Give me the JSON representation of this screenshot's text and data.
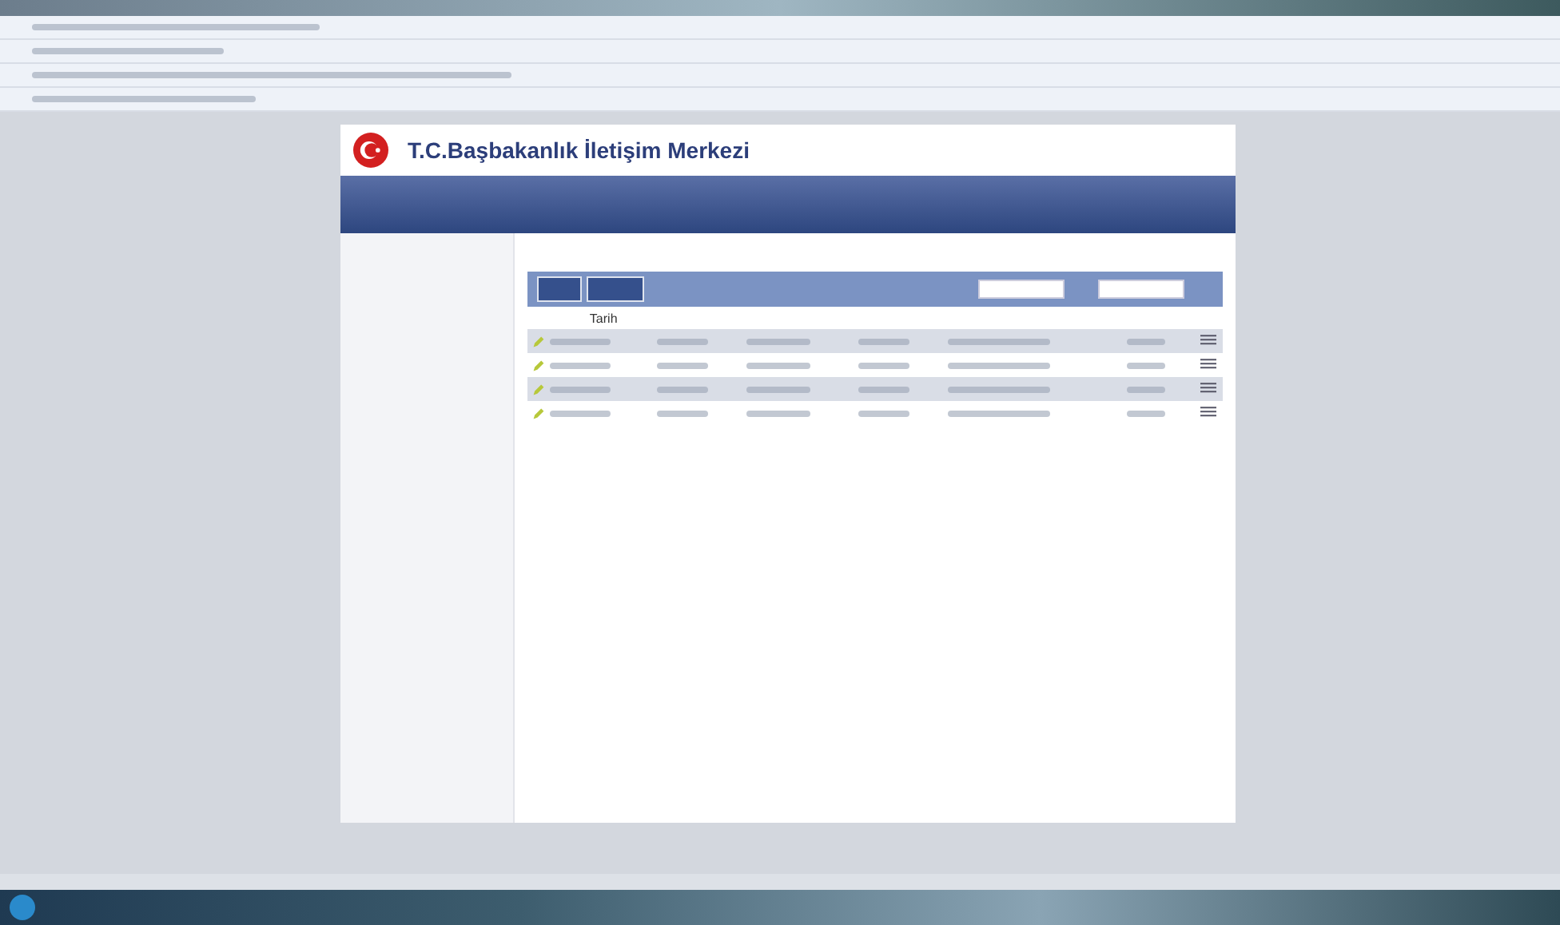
{
  "site": {
    "title": "T.C.Başbakanlık İletişim Merkezi"
  },
  "table": {
    "columns": [
      {
        "label": "Tarih"
      },
      {},
      {},
      {},
      {},
      {}
    ],
    "rows": [
      {
        "shaded": true
      },
      {
        "shaded": false
      },
      {
        "shaded": true
      },
      {
        "shaded": false
      }
    ]
  }
}
